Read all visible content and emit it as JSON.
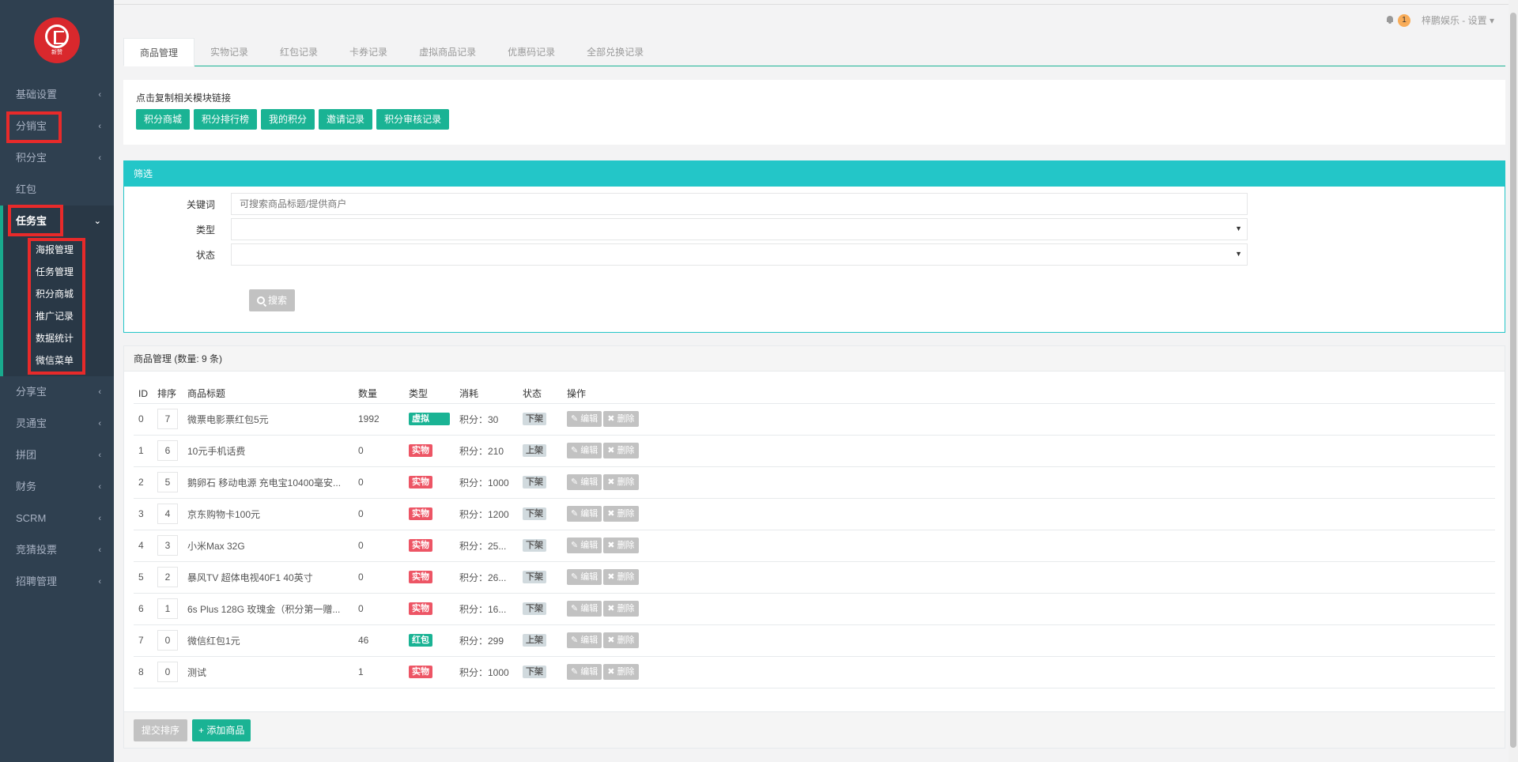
{
  "sidebar": {
    "logo_text": "新赞",
    "items": [
      {
        "label": "基础设置",
        "arrow": "‹"
      },
      {
        "label": "分销宝",
        "arrow": "‹"
      },
      {
        "label": "积分宝",
        "arrow": "‹"
      },
      {
        "label": "红包",
        "arrow": ""
      },
      {
        "label": "任务宝",
        "arrow": "⌄"
      },
      {
        "label": "分享宝",
        "arrow": "‹"
      },
      {
        "label": "灵通宝",
        "arrow": "‹"
      },
      {
        "label": "拼团",
        "arrow": "‹"
      },
      {
        "label": "财务",
        "arrow": "‹"
      },
      {
        "label": "SCRM",
        "arrow": "‹"
      },
      {
        "label": "竞猜投票",
        "arrow": "‹"
      },
      {
        "label": "招聘管理",
        "arrow": "‹"
      }
    ],
    "submenu": [
      "海报管理",
      "任务管理",
      "积分商城",
      "推广记录",
      "数据统计",
      "微信菜单"
    ]
  },
  "header": {
    "notification_count": "1",
    "user_menu": "梓鹏娱乐 - 设置 ▾"
  },
  "tabs": [
    "商品管理",
    "实物记录",
    "红包记录",
    "卡券记录",
    "虚拟商品记录",
    "优惠码记录",
    "全部兑换记录"
  ],
  "links": {
    "title": "点击复制相关模块链接",
    "buttons": [
      "积分商城",
      "积分排行榜",
      "我的积分",
      "邀请记录",
      "积分审核记录"
    ]
  },
  "filter": {
    "title": "筛选",
    "keyword_label": "关键词",
    "keyword_placeholder": "可搜索商品标题/提供商户",
    "type_label": "类型",
    "status_label": "状态",
    "search_button": "搜索"
  },
  "list": {
    "title": "商品管理 (数量: 9 条)",
    "columns": [
      "ID",
      "排序",
      "商品标题",
      "数量",
      "类型",
      "消耗",
      "状态",
      "操作"
    ],
    "edit_label": "编辑",
    "delete_label": "删除",
    "rows": [
      {
        "id": "0",
        "sort": "7",
        "title": "微票电影票红包5元",
        "qty": "1992",
        "type": "虚拟",
        "cost": "积分：30",
        "status": "下架"
      },
      {
        "id": "1",
        "sort": "6",
        "title": "10元手机话费",
        "qty": "0",
        "type": "实物",
        "cost": "积分：210",
        "status": "上架"
      },
      {
        "id": "2",
        "sort": "5",
        "title": "鹅卵石 移动电源 充电宝10400毫安...",
        "qty": "0",
        "type": "实物",
        "cost": "积分：1000",
        "status": "下架"
      },
      {
        "id": "3",
        "sort": "4",
        "title": "京东购物卡100元",
        "qty": "0",
        "type": "实物",
        "cost": "积分：1200",
        "status": "下架"
      },
      {
        "id": "4",
        "sort": "3",
        "title": "小米Max 32G",
        "qty": "0",
        "type": "实物",
        "cost": "积分：25...",
        "status": "下架"
      },
      {
        "id": "5",
        "sort": "2",
        "title": "暴风TV 超体电视40F1 40英寸",
        "qty": "0",
        "type": "实物",
        "cost": "积分：26...",
        "status": "下架"
      },
      {
        "id": "6",
        "sort": "1",
        "title": "6s Plus 128G 玫瑰金（积分第一赠...",
        "qty": "0",
        "type": "实物",
        "cost": "积分：16...",
        "status": "下架"
      },
      {
        "id": "7",
        "sort": "0",
        "title": "微信红包1元",
        "qty": "46",
        "type": "红包",
        "cost": "积分：299",
        "status": "上架"
      },
      {
        "id": "8",
        "sort": "0",
        "title": "测试",
        "qty": "1",
        "type": "实物",
        "cost": "积分：1000",
        "status": "下架"
      }
    ],
    "submit_sort_button": "提交排序",
    "add_button": "+ 添加商品"
  }
}
